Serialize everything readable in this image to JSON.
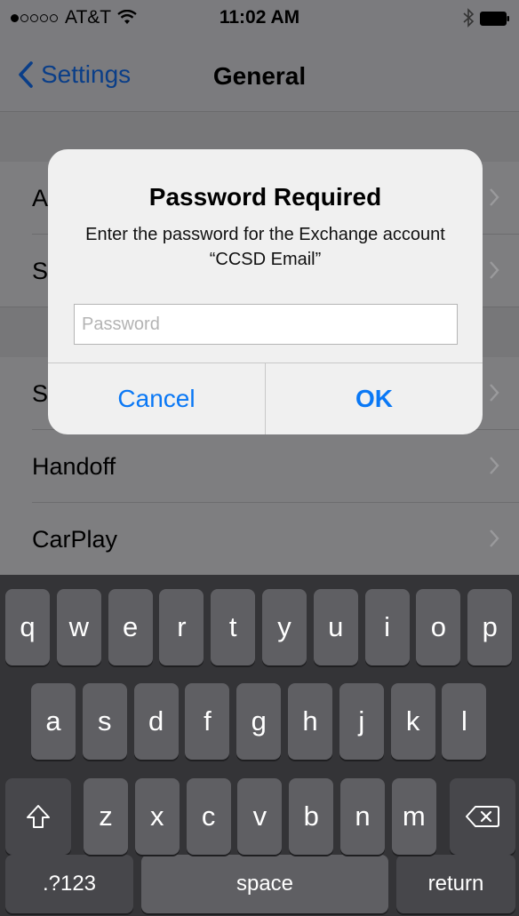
{
  "status_bar": {
    "carrier": "AT&T",
    "time": "11:02 AM",
    "signal_bars": [
      true,
      false,
      false,
      false,
      false
    ]
  },
  "nav": {
    "back_label": "Settings",
    "title": "General"
  },
  "list": {
    "rows": [
      {
        "label": "A",
        "group_start": true
      },
      {
        "label": "S",
        "group_end": true
      },
      {
        "label": "S",
        "group_start": true
      },
      {
        "label": "Handoff"
      },
      {
        "label": "CarPlay"
      }
    ]
  },
  "dialog": {
    "title": "Password Required",
    "message": "Enter the password for the Exchange account “CCSD Email”",
    "input_placeholder": "Password",
    "input_value": "",
    "cancel_label": "Cancel",
    "ok_label": "OK"
  },
  "keyboard": {
    "row1": [
      "q",
      "w",
      "e",
      "r",
      "t",
      "y",
      "u",
      "i",
      "o",
      "p"
    ],
    "row2": [
      "a",
      "s",
      "d",
      "f",
      "g",
      "h",
      "j",
      "k",
      "l"
    ],
    "row3": [
      "z",
      "x",
      "c",
      "v",
      "b",
      "n",
      "m"
    ],
    "shift_icon": "shift-icon",
    "delete_icon": "delete-icon",
    "numbers_label": ".?123",
    "space_label": "space",
    "return_label": "return"
  },
  "colors": {
    "accent": "#0a78f5",
    "dimmed_background": "#7b7b7e",
    "keyboard_background": "#343437",
    "key_background": "#5f5f63"
  }
}
